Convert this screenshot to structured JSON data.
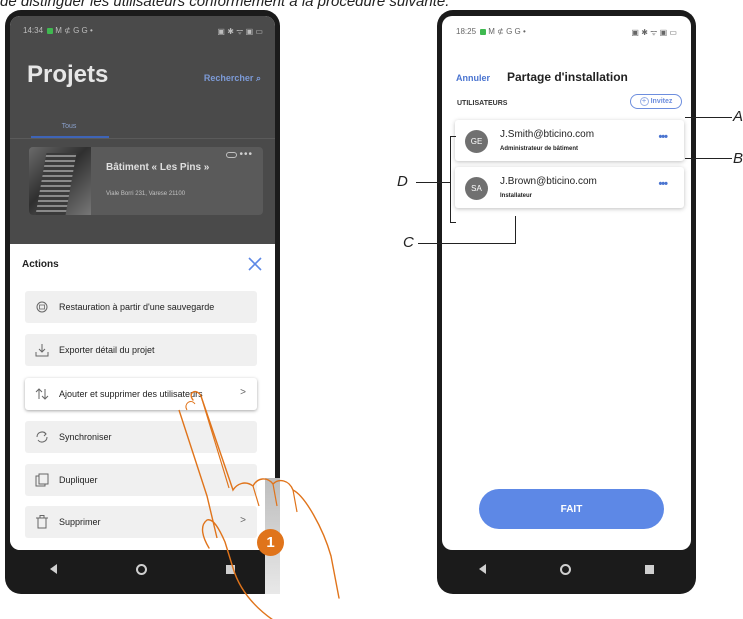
{
  "caption": "de distinguer les utilisateurs conformément à la procédure suivante.",
  "left_phone": {
    "status_time": "14:34",
    "status_icons_left": "M ⊄ G G •",
    "status_icons_right": "▣ ✱ ᯤ ▣ ▭",
    "page_title": "Projets",
    "search_label": "Rechercher",
    "tab_all": "Tous",
    "project": {
      "name": "Bâtiment « Les Pins »",
      "address": "Viale Borri 231, Varese 21100",
      "more": "•••"
    },
    "sheet_title": "Actions",
    "actions": [
      {
        "label": "Restauration à partir d'une sauvegarde",
        "icon": "restore-icon",
        "chevron": ""
      },
      {
        "label": "Exporter détail du projet",
        "icon": "download-icon",
        "chevron": ""
      },
      {
        "label": "Ajouter et supprimer des utilisateurs",
        "icon": "add-remove-users-icon",
        "chevron": ">"
      },
      {
        "label": "Synchroniser",
        "icon": "sync-icon",
        "chevron": ""
      },
      {
        "label": "Dupliquer",
        "icon": "duplicate-icon",
        "chevron": ""
      },
      {
        "label": "Supprimer",
        "icon": "trash-icon",
        "chevron": ">"
      }
    ],
    "step_number": "1"
  },
  "right_phone": {
    "status_time": "18:25",
    "status_icons_left": "M ⊄ G G •",
    "status_icons_right": "▣ ✱ ᯤ ▣ ▭",
    "cancel_label": "Annuler",
    "title": "Partage d'installation",
    "section_label": "UTILISATEURS",
    "invite_label": "Invitez",
    "users": [
      {
        "initials": "GE",
        "email": "J.Smith@bticino.com",
        "role": "Administrateur de bâtiment",
        "more": "•••"
      },
      {
        "initials": "SA",
        "email": "J.Brown@bticino.com",
        "role": "Installateur",
        "more": "•••"
      }
    ],
    "done_label": "FAIT"
  },
  "callouts": {
    "a": "A",
    "b": "B",
    "c": "C",
    "d": "D"
  }
}
